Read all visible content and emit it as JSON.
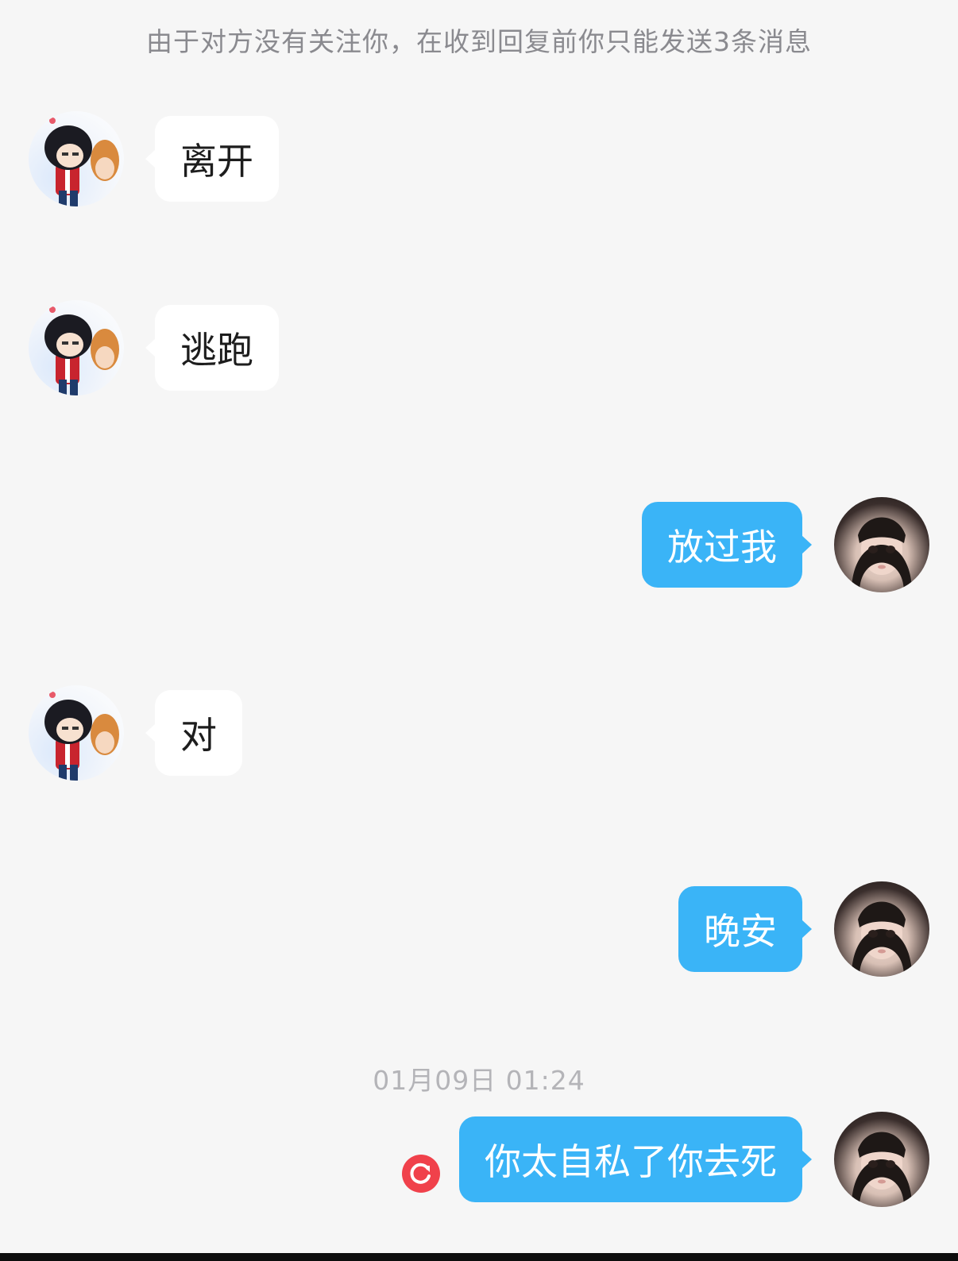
{
  "notice": "由于对方没有关注你，在收到回复前你只能发送3条消息",
  "messages": [
    {
      "side": "in",
      "text": "离开"
    },
    {
      "side": "in",
      "text": "逃跑"
    },
    {
      "side": "out",
      "text": "放过我"
    },
    {
      "side": "in",
      "text": "对"
    },
    {
      "side": "out",
      "text": "晚安"
    },
    {
      "side": "out",
      "text": "你太自私了你去死",
      "status": "failed"
    }
  ],
  "timestamp": "01月09日 01:24",
  "colors": {
    "background": "#f6f6f6",
    "incoming_bubble": "#ffffff",
    "outgoing_bubble": "#3ab4f7",
    "error": "#f0414b"
  }
}
